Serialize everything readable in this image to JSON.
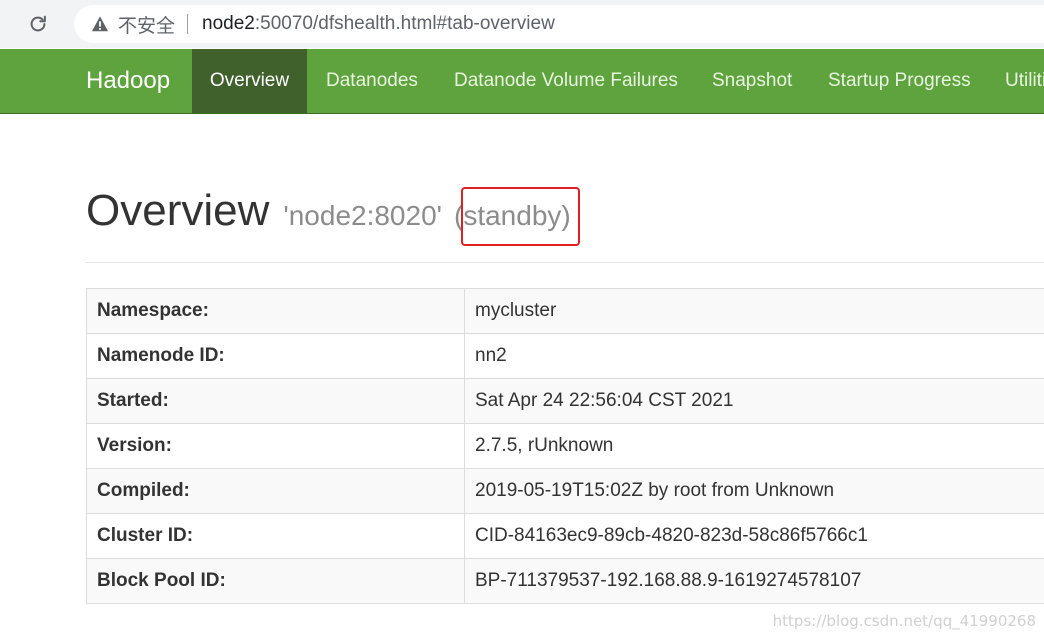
{
  "browser": {
    "reload_icon": "reload-icon",
    "warning_icon": "warning-icon",
    "security_label": "不安全",
    "url_host": "node2",
    "url_rest": ":50070/dfshealth.html#tab-overview"
  },
  "navbar": {
    "brand": "Hadoop",
    "items": [
      {
        "label": "Overview"
      },
      {
        "label": "Datanodes"
      },
      {
        "label": "Datanode Volume Failures"
      },
      {
        "label": "Snapshot"
      },
      {
        "label": "Startup Progress"
      },
      {
        "label": "Utilities"
      }
    ],
    "colors": {
      "bar": "#5fa33e",
      "active": "#40612c"
    }
  },
  "overview": {
    "title": "Overview",
    "host": "'node2:8020'",
    "state": "(standby)",
    "highlight_color": "#e02020"
  },
  "info_table": [
    {
      "key": "Namespace:",
      "value": "mycluster"
    },
    {
      "key": "Namenode ID:",
      "value": "nn2"
    },
    {
      "key": "Started:",
      "value": "Sat Apr 24 22:56:04 CST 2021"
    },
    {
      "key": "Version:",
      "value": "2.7.5, rUnknown"
    },
    {
      "key": "Compiled:",
      "value": "2019-05-19T15:02Z by root from Unknown"
    },
    {
      "key": "Cluster ID:",
      "value": "CID-84163ec9-89cb-4820-823d-58c86f5766c1"
    },
    {
      "key": "Block Pool ID:",
      "value": "BP-711379537-192.168.88.9-1619274578107"
    }
  ],
  "watermark": "https://blog.csdn.net/qq_41990268"
}
